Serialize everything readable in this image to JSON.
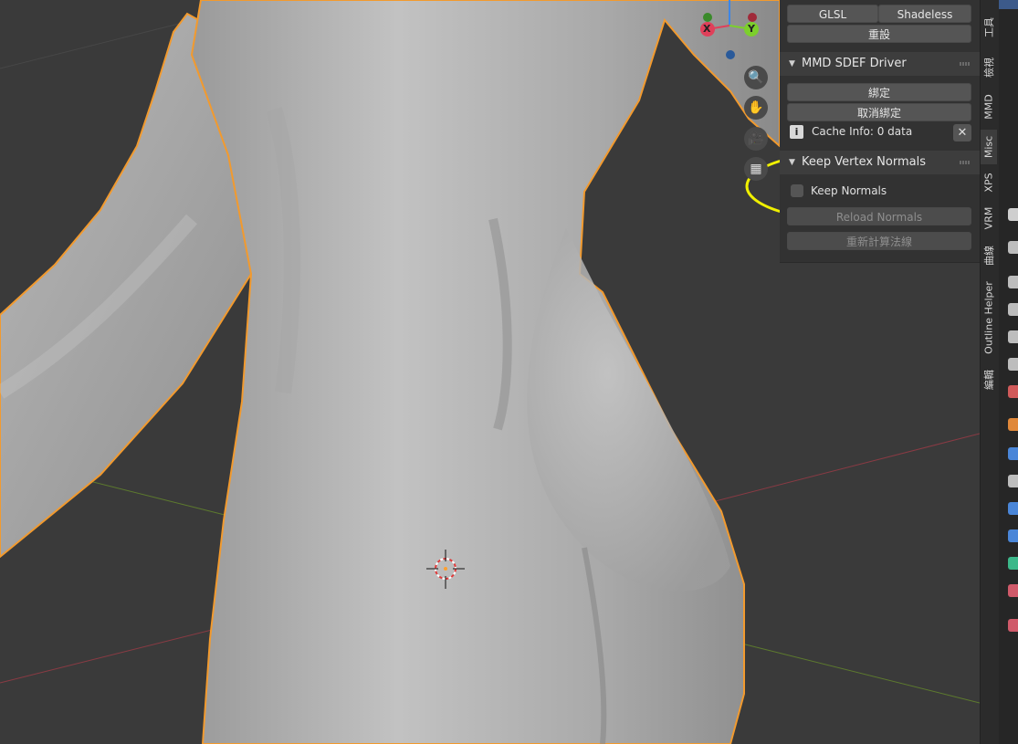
{
  "viewport": {
    "nav_gizmo": {
      "x_label": "X",
      "y_label": "Y"
    },
    "nav_buttons": [
      "zoom-icon",
      "hand-icon",
      "camera-icon",
      "grid-icon"
    ]
  },
  "sidebar": {
    "shading_row": {
      "glsl_label": "GLSL",
      "shadeless_label": "Shadeless"
    },
    "reset_label": "重設",
    "sdef_panel": {
      "title": "MMD SDEF Driver",
      "bind_label": "綁定",
      "unbind_label": "取消綁定",
      "cache_info": "Cache Info: 0 data"
    },
    "normals_panel": {
      "title": "Keep Vertex Normals",
      "keep_normals_label": "Keep Normals",
      "keep_normals_checked": false,
      "reload_label": "Reload Normals",
      "recalc_label": "重新計算法線"
    }
  },
  "tabs": {
    "items": [
      {
        "label": "工具",
        "active": false
      },
      {
        "label": "檢視",
        "active": false
      },
      {
        "label": "MMD",
        "active": false
      },
      {
        "label": "Misc",
        "active": true
      },
      {
        "label": "XPS",
        "active": false
      },
      {
        "label": "VRM",
        "active": false
      },
      {
        "label": "曲線",
        "active": false
      },
      {
        "label": "Outline Helper",
        "active": false
      },
      {
        "label": "編輯",
        "active": false
      }
    ]
  },
  "colors": {
    "selection_outline": "#f29a2e",
    "highlight_ellipse": "#f0f000",
    "axis_x": "#e0405a",
    "axis_y": "#7ccf2c",
    "axis_z": "#3d86e6"
  }
}
